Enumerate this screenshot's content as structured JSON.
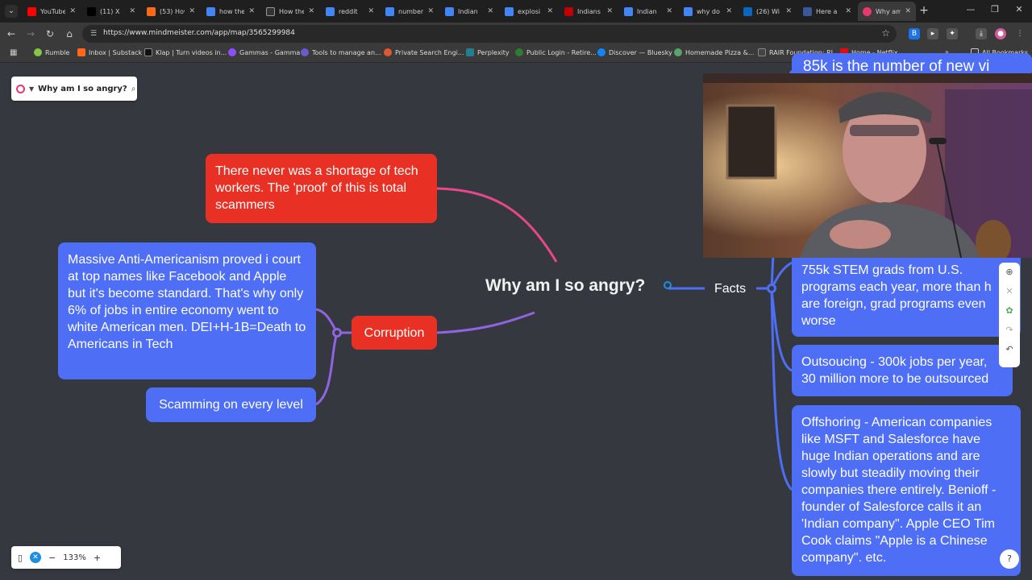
{
  "browser": {
    "tabs": [
      {
        "title": "YouTube",
        "color": "#ff0000"
      },
      {
        "title": "(11) X",
        "color": "#000000"
      },
      {
        "title": "(53) How",
        "color": "#ff6719"
      },
      {
        "title": "how the",
        "color": "#4285f4"
      },
      {
        "title": "How the",
        "color": "#333333"
      },
      {
        "title": "reddit",
        "color": "#4285f4"
      },
      {
        "title": "number",
        "color": "#4285f4"
      },
      {
        "title": "Indian",
        "color": "#4285f4"
      },
      {
        "title": "explosi",
        "color": "#4285f4"
      },
      {
        "title": "Indians",
        "color": "#c00000"
      },
      {
        "title": "Indian",
        "color": "#4285f4"
      },
      {
        "title": "why do",
        "color": "#4285f4"
      },
      {
        "title": "(26) Wi",
        "color": "#0a66c2"
      },
      {
        "title": "Here a",
        "color": "#3b5998"
      },
      {
        "title": "Why am",
        "color": "#e8386d"
      }
    ],
    "url": "https://www.mindmeister.com/app/map/3565299984",
    "bookmarks": [
      {
        "label": "Rumble",
        "color": "#85c742"
      },
      {
        "label": "Inbox | Substack",
        "color": "#ff6719"
      },
      {
        "label": "Klap | Turn videos in...",
        "color": "#111111"
      },
      {
        "label": "Gammas - Gamma",
        "color": "#8a4fff"
      },
      {
        "label": "Tools to manage an...",
        "color": "#6a5acd"
      },
      {
        "label": "Private Search Engi...",
        "color": "#de5833"
      },
      {
        "label": "Perplexity",
        "color": "#20808d"
      },
      {
        "label": "Public Login - Retire...",
        "color": "#2e7d32"
      },
      {
        "label": "Discover — Bluesky",
        "color": "#1185fe"
      },
      {
        "label": "Homemade Pizza &...",
        "color": "#5aa469"
      },
      {
        "label": "RAIR Foundation: RI...",
        "color": "#444444"
      },
      {
        "label": "Home - Netflix",
        "color": "#e50914"
      }
    ],
    "all_bookmarks": "All Bookmarks"
  },
  "map": {
    "title": "Why am I so angry?",
    "center": "Why am I so angry?",
    "nodes": {
      "shortage": "There never was a shortage of tech workers. The 'proof' of this is total scammers",
      "anti_american": "Massive Anti-Americanism proved i court at top names like Facebook and Apple but it's become standard. That's why only 6% of jobs in entire economy went to white American men. DEI+H-1B=Death to Americans in Tech",
      "corruption": "Corruption",
      "scamming": "Scamming on every level",
      "facts": "Facts",
      "top_partial": "85k is the number of new vi",
      "stem": "755k  STEM grads from U.S. programs each year, more than h are foreign, grad programs even worse",
      "outsourcing": "Outsoucing - 300k jobs per year, 30 million more to be outsourced",
      "offshoring": "Offshoring - American companies like MSFT and Salesforce have huge Indian operations and are slowly but steadily moving their companies there entirely. Benioff - founder of Salesforce calls it an 'Indian company\". Apple CEO Tim Cook claims \"Apple is a Chinese company\". etc."
    },
    "zoom": "133%",
    "colors": {
      "background": "#35393f",
      "red_node": "#e83124",
      "blue_node": "#4d6ef5",
      "pink_link": "#e8478b",
      "purple_link": "#8f64e0",
      "blue_link": "#4d6ef5"
    }
  }
}
